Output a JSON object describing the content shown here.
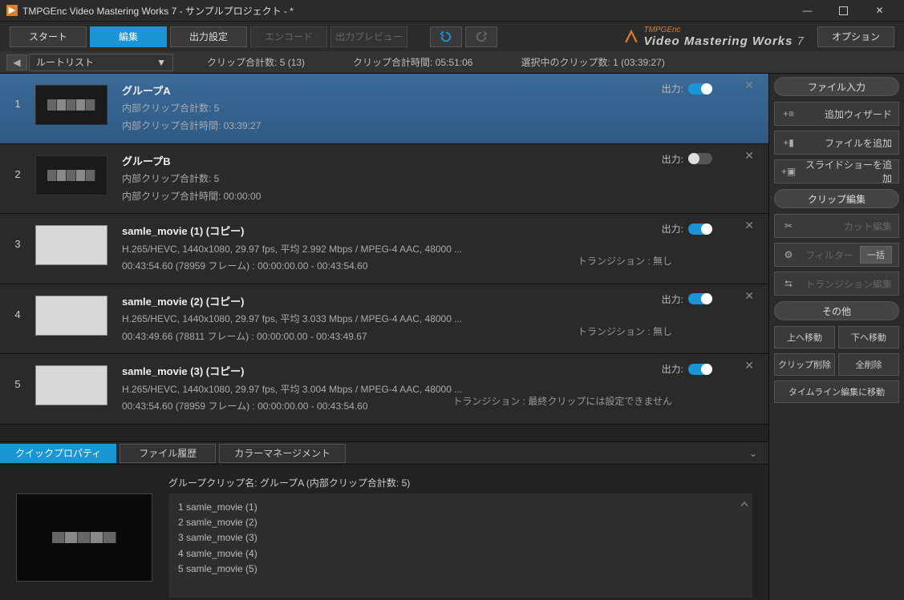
{
  "title": "TMPGEnc Video Mastering Works 7 - サンプルプロジェクト - *",
  "tabs": {
    "start": "スタート",
    "edit": "編集",
    "output": "出力設定",
    "encode": "エンコード",
    "preview": "出力プレビュー"
  },
  "brand": {
    "small": "TMPGEnc",
    "main": "Video Mastering Works 7"
  },
  "option": "オプション",
  "dropdown": "ルートリスト",
  "stats": {
    "count_label": "クリップ合計数:",
    "count": "5 (13)",
    "time_label": "クリップ合計時間:",
    "time": "05:51:06",
    "sel_label": "選択中のクリップ数:",
    "sel": "1 (03:39:27)"
  },
  "outlabel": "出力:",
  "clips": [
    {
      "num": "1",
      "name": "グループA",
      "l1": "内部クリップ合計数: 5",
      "l2": "内部クリップ合計時間: 03:39:27",
      "group": true,
      "on": true,
      "selected": true
    },
    {
      "num": "2",
      "name": "グループB",
      "l1": "内部クリップ合計数: 5",
      "l2": "内部クリップ合計時間: 00:00:00",
      "group": true,
      "on": false
    },
    {
      "num": "3",
      "name": "samle_movie (1) (コピー)",
      "l1": "H.265/HEVC,  1440x1080,  29.97 fps,  平均 2.992 Mbps / MPEG-4 AAC,  48000 ...",
      "l2": "00:43:54.60 (78959 フレーム) :  00:00:00.00 - 00:43:54.60",
      "trans": "トランジション : 無し",
      "on": true
    },
    {
      "num": "4",
      "name": "samle_movie (2) (コピー)",
      "l1": "H.265/HEVC,  1440x1080,  29.97 fps,  平均 3.033 Mbps / MPEG-4 AAC,  48000 ...",
      "l2": "00:43:49.66 (78811 フレーム) :  00:00:00.00 - 00:43:49.67",
      "trans": "トランジション : 無し",
      "on": true
    },
    {
      "num": "5",
      "name": "samle_movie (3) (コピー)",
      "l1": "H.265/HEVC,  1440x1080,  29.97 fps,  平均 3.004 Mbps / MPEG-4 AAC,  48000 ...",
      "l2": "00:43:54.60 (78959 フレーム) :  00:00:00.00 - 00:43:54.60",
      "trans": "トランジション : 最終クリップには設定できません",
      "on": true
    }
  ],
  "btabs": {
    "quick": "クイックプロパティ",
    "history": "ファイル履歴",
    "color": "カラーマネージメント"
  },
  "prop": {
    "title": "グループクリップ名: グループA (内部クリップ合計数: 5)",
    "items": [
      "samle_movie (1)",
      "samle_movie (2)",
      "samle_movie (3)",
      "samle_movie (4)",
      "samle_movie (5)"
    ]
  },
  "side": {
    "file": "ファイル入力",
    "wizard": "追加ウィザード",
    "addfile": "ファイルを追加",
    "addslide": "スライドショーを追加",
    "edit": "クリップ編集",
    "cut": "カット編集",
    "filter": "フィルター",
    "batch": "一括",
    "transedit": "トランジション編集",
    "other": "その他",
    "moveup": "上へ移動",
    "movedown": "下へ移動",
    "delclip": "クリップ削除",
    "delall": "全削除",
    "timeline": "タイムライン編集に移動"
  }
}
